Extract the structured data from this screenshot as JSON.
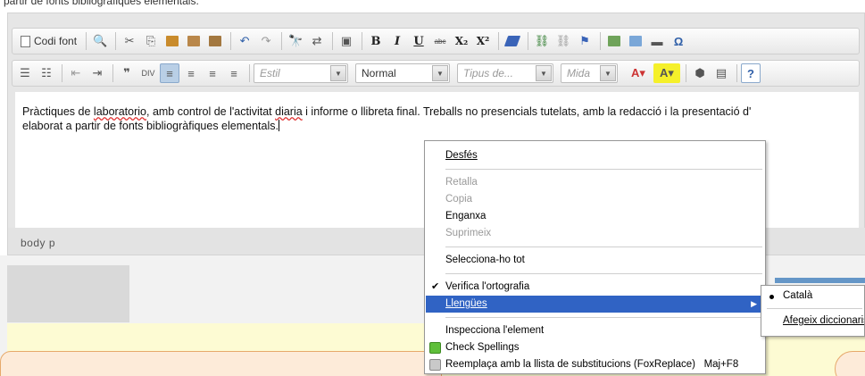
{
  "top_clip_text": "partir de fonts bibliogràfiques elementals.",
  "toolbar1": {
    "source_label": "Codi font",
    "bold": "B",
    "italic": "I",
    "underline": "U",
    "strike": "abc",
    "subscript": "X₂",
    "superscript": "X²",
    "omega": "Ω"
  },
  "toolbar2": {
    "style_placeholder": "Estil",
    "format_value": "Normal",
    "font_placeholder": "Tipus de...",
    "size_placeholder": "Mida",
    "help": "?"
  },
  "content": {
    "line1_pre": "Pràctiques de ",
    "line1_word": "laboratorio",
    "line1_mid": ", amb control de l'activitat ",
    "line1_word2": "diaria",
    "line1_post": " i informe o llibreta final. Treballs no presencials tutelats, amb la redacció i la presentació d'",
    "line2": "elaborat a partir de fonts bibliogràfiques elementals."
  },
  "pathbar": "body  p",
  "context_menu": {
    "undo": "Desfés",
    "cut": "Retalla",
    "copy": "Copia",
    "paste": "Enganxa",
    "delete": "Suprimeix",
    "select_all": "Selecciona-ho tot",
    "spellcheck": "Verifica l'ortografia",
    "languages": "Llengües",
    "inspect": "Inspecciona l'element",
    "check_spellings": "Check Spellings",
    "replace": "Reemplaça amb la llista de substitucions (FoxReplace)",
    "replace_shortcut": "Maj+F8"
  },
  "submenu": {
    "catala": "Català",
    "add_dictionaries": "Afegeix diccionaris..."
  },
  "colors": {
    "highlight": "#3063c4",
    "panel": "#e6e6e6",
    "yellow": "#fdfbd3"
  }
}
